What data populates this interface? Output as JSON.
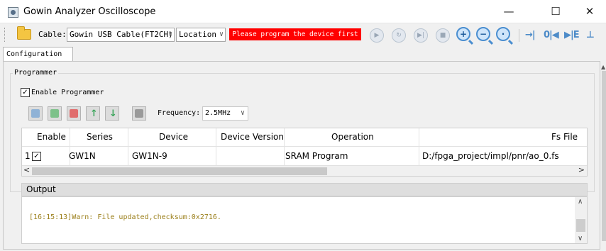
{
  "window": {
    "title": "Gowin Analyzer Oscilloscope",
    "minimize": "—",
    "maximize": "☐",
    "close": "✕"
  },
  "toolbar": {
    "cable_label": "Cable:",
    "cable_value": "Gowin USB Cable(FT2CH)",
    "location_value": "Location",
    "warning": "Please program the device first",
    "icons": [
      "open-folder-icon",
      "run-icon",
      "loop-icon",
      "step-icon",
      "stop-icon",
      "zoom-in-icon",
      "zoom-out-icon",
      "zoom-fit-icon",
      "go-to-end-icon",
      "go-to-trigger-icon",
      "next-marker-icon",
      "trigger-edge-icon"
    ]
  },
  "tabs": {
    "configuration": "Configuration"
  },
  "programmer": {
    "group_title": "Programmer",
    "enable_label": "Enable Programmer",
    "enabled": true,
    "frequency_label": "Frequency:",
    "frequency_value": "2.5MHz",
    "buttons": [
      "scan-device-icon",
      "add-device-icon",
      "remove-device-icon",
      "move-up-icon",
      "move-down-icon",
      "program-icon"
    ]
  },
  "table": {
    "headers": {
      "enable": "Enable",
      "series": "Series",
      "device": "Device",
      "version": "Device Version",
      "operation": "Operation",
      "fsfile": "Fs File"
    },
    "rows": [
      {
        "index": "1",
        "enabled": true,
        "series": "GW1N",
        "device": "GW1N-9",
        "version": "",
        "operation": "SRAM Program",
        "fsfile": "D:/fpga_project/impl/pnr/ao_0.fs"
      }
    ]
  },
  "output": {
    "title": "Output",
    "lines": [
      "[16:15:13]Warn: File updated,checksum:0x2716."
    ]
  },
  "colors": {
    "warning_bg": "#ff0000",
    "warning_text": "#ffffff",
    "log_warn": "#9b7f1a",
    "accent": "#4a8ed0"
  }
}
